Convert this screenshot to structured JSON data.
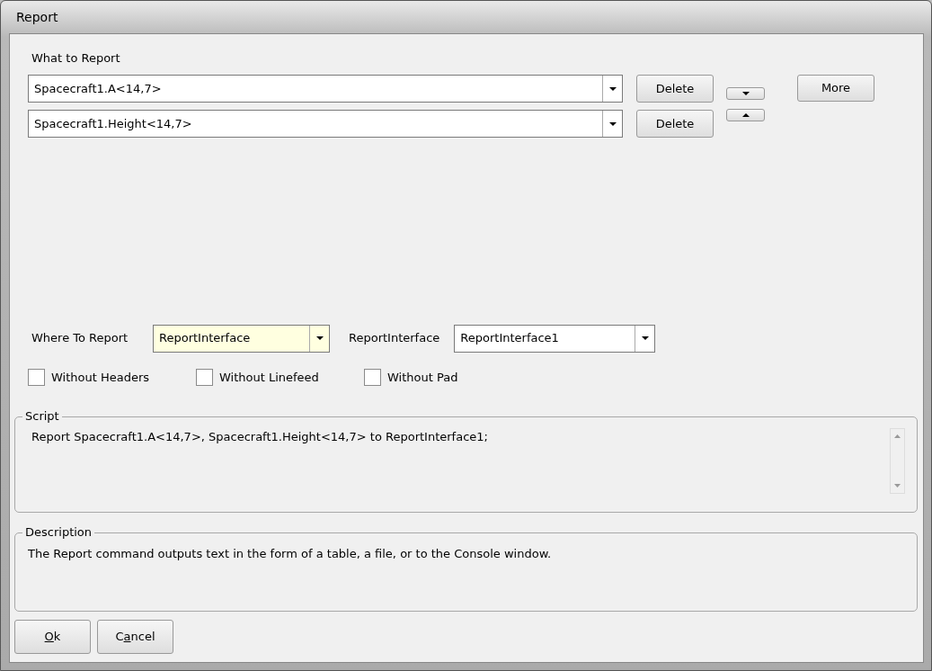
{
  "window": {
    "title": "Report"
  },
  "what_to_report": {
    "label": "What to Report",
    "items": [
      {
        "value": "Spacecraft1.A<14,7>",
        "delete_label": "Delete"
      },
      {
        "value": "Spacecraft1.Height<14,7>",
        "delete_label": "Delete"
      }
    ],
    "more_label": "More"
  },
  "where_to_report": {
    "label": "Where To Report",
    "value": "ReportInterface",
    "highlighted": true
  },
  "report_interface": {
    "label": "ReportInterface",
    "value": "ReportInterface1",
    "highlighted": false
  },
  "options": [
    {
      "label": "Without Headers",
      "checked": false
    },
    {
      "label": "Without Linefeed",
      "checked": false
    },
    {
      "label": "Without Pad",
      "checked": false
    }
  ],
  "script": {
    "title": "Script",
    "text": "Report Spacecraft1.A<14,7>, Spacecraft1.Height<14,7> to ReportInterface1;"
  },
  "description": {
    "title": "Description",
    "text": "The Report command outputs text in the form of a table, a file, or to the Console window."
  },
  "buttons": [
    {
      "access_key": "O",
      "after": "k"
    },
    {
      "before": "C",
      "access_key": "a",
      "after": "ncel"
    }
  ]
}
